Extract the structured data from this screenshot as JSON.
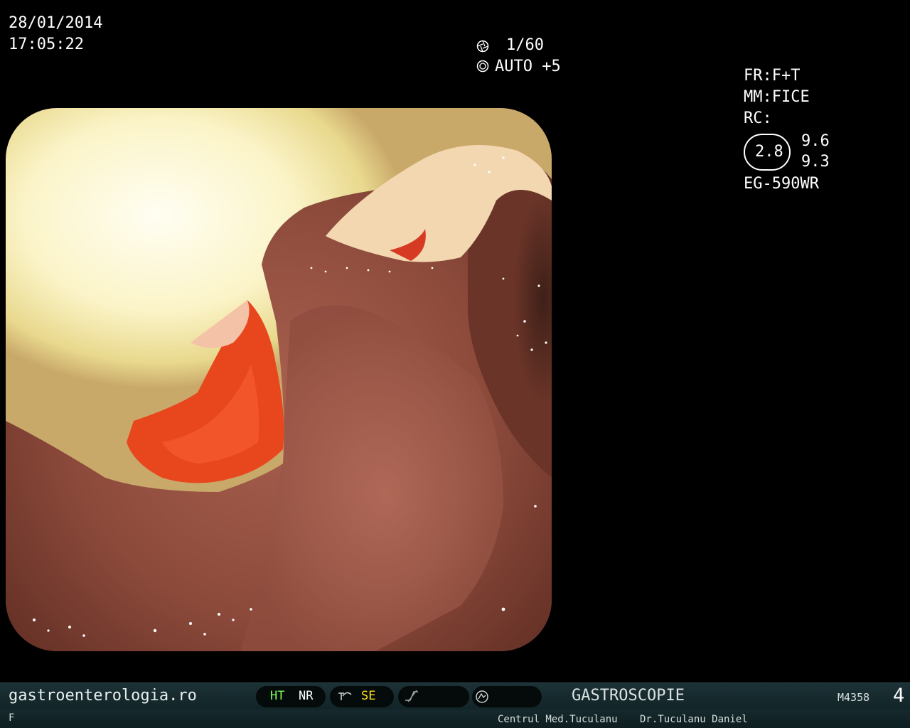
{
  "header": {
    "date": "28/01/2014",
    "time": "17:05:22"
  },
  "exposure": {
    "shutter": "1/60",
    "auto": "AUTO +5",
    "shutter_icon": "aperture-icon",
    "auto_icon": "iris-icon"
  },
  "settings": {
    "fr": "FR:F+T",
    "mm": "MM:FICE",
    "rc": "RC:",
    "ratio": "2.8",
    "val1": "9.6",
    "val2": "9.3",
    "scope": "EG-590WR"
  },
  "statusbar": {
    "website": "gastroenterologia.ro",
    "ht": "HT",
    "nr": "NR",
    "se": "SE",
    "procedure": "GASTROSCOPIE",
    "code": "M4358",
    "number": "4",
    "colors": {
      "ht": "#7cff5a",
      "se": "#ffe11a"
    }
  },
  "footer": {
    "flag": "F",
    "center": "Centrul Med.Tuculanu",
    "doctor": "Dr.Tuculanu Daniel"
  }
}
